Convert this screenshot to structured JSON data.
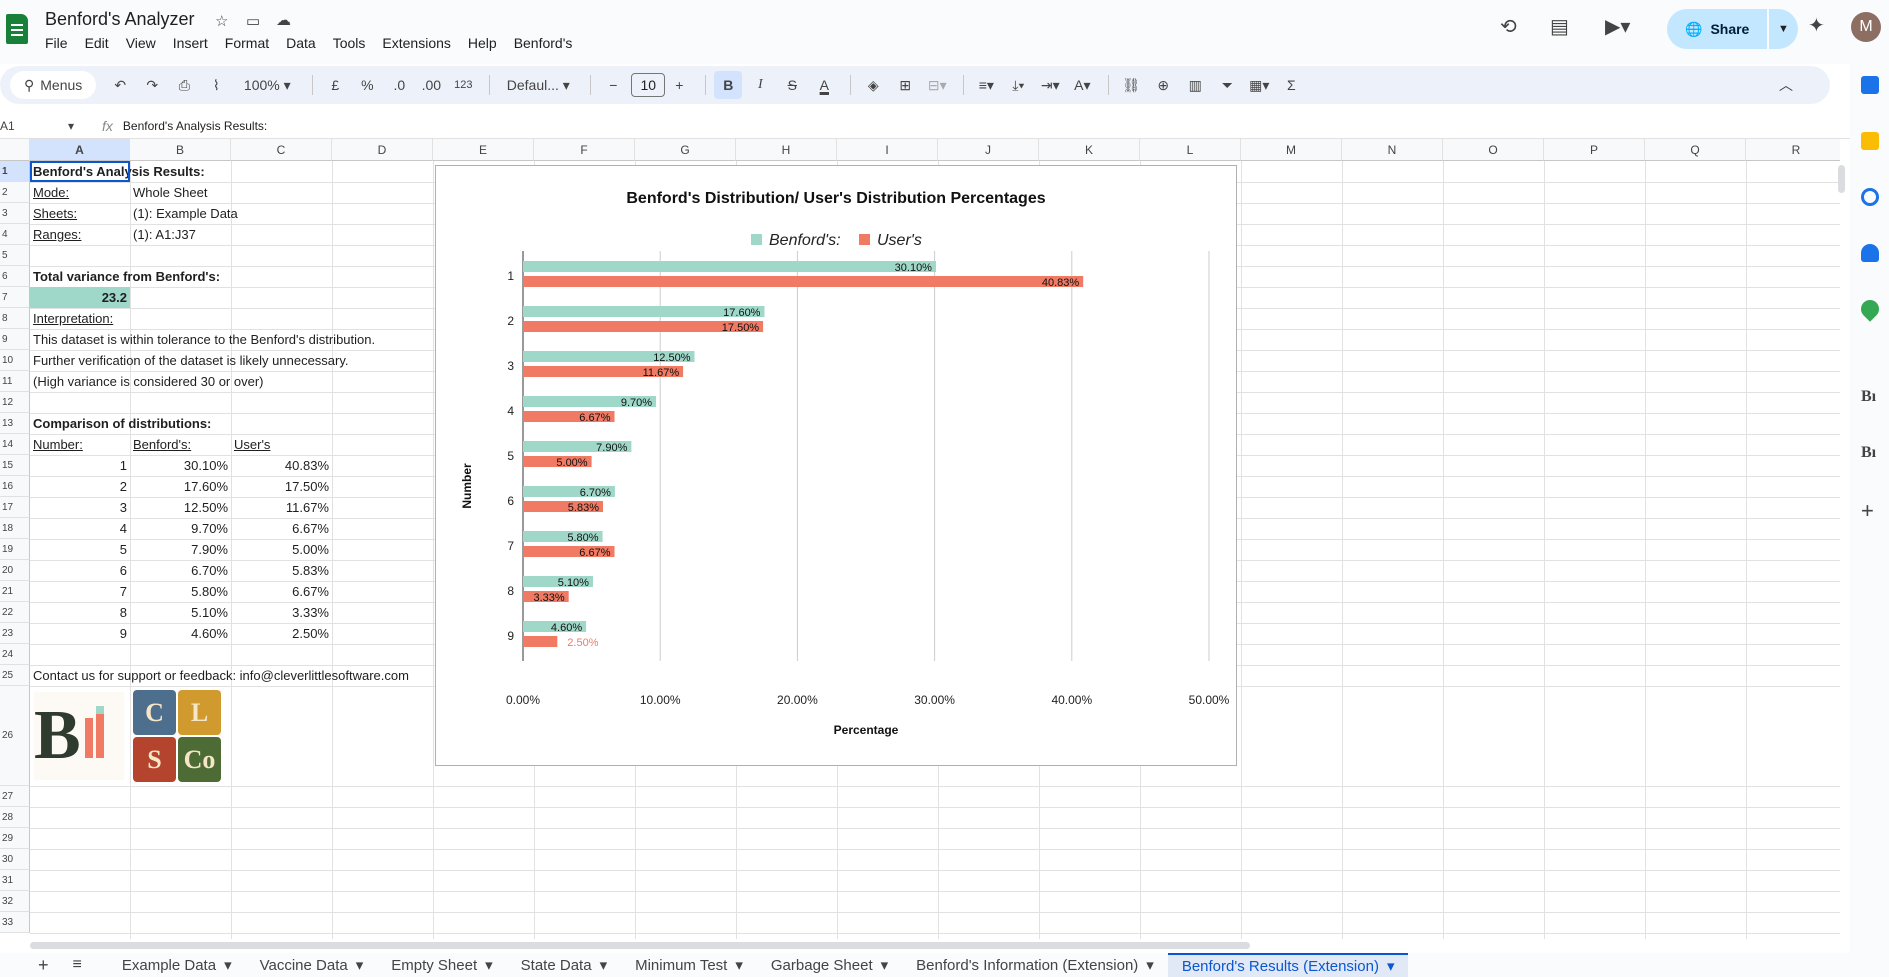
{
  "app": {
    "title": "Benford's Analyzer",
    "menus": [
      "File",
      "Edit",
      "View",
      "Insert",
      "Format",
      "Data",
      "Tools",
      "Extensions",
      "Help",
      "Benford's"
    ],
    "share_label": "Share",
    "avatar_initial": "M"
  },
  "toolbar": {
    "search_label": "Menus",
    "zoom": "100%",
    "currency": "£",
    "percent": "%",
    "dec_decrease": ".0",
    "dec_increase": ".00",
    "number_format": "123",
    "font": "Defaul...",
    "font_size": "10",
    "bold": "B",
    "italic": "I",
    "strike": "S",
    "text_color": "A"
  },
  "formula_bar": {
    "cell_ref": "A1",
    "content": "Benford's Analysis Results:"
  },
  "columns": [
    "A",
    "B",
    "C",
    "D",
    "E",
    "F",
    "G",
    "H",
    "I",
    "J",
    "K",
    "L",
    "M",
    "N",
    "O",
    "P",
    "Q",
    "R"
  ],
  "rows": [
    "1",
    "2",
    "3",
    "4",
    "5",
    "6",
    "7",
    "8",
    "9",
    "10",
    "11",
    "12",
    "13",
    "14",
    "15",
    "16",
    "17",
    "18",
    "19",
    "20",
    "21",
    "22",
    "23",
    "24",
    "25",
    "26",
    "27",
    "28",
    "29",
    "30",
    "31",
    "32",
    "33"
  ],
  "sheet": {
    "a1": "Benford's Analysis Results:",
    "mode_label": "Mode:",
    "mode_value": "Whole Sheet",
    "sheets_label": "Sheets:",
    "sheets_value": "(1): Example Data",
    "ranges_label": "Ranges:",
    "ranges_value": "(1): A1:J37",
    "variance_label": "Total variance from Benford's:",
    "variance_value": "23.2",
    "interp_label": "Interpretation:",
    "interp_1": "This dataset is within tolerance to the Benford's distribution.",
    "interp_2": "Further verification of the dataset is likely unnecessary.",
    "interp_3": "(High variance is considered 30 or over)",
    "comparison_title": "Comparison of distributions:",
    "col_number": "Number:",
    "col_benford": "Benford's:",
    "col_user": "User's",
    "table": [
      [
        "1",
        "30.10%",
        "40.83%"
      ],
      [
        "2",
        "17.60%",
        "17.50%"
      ],
      [
        "3",
        "12.50%",
        "11.67%"
      ],
      [
        "4",
        "9.70%",
        "6.67%"
      ],
      [
        "5",
        "7.90%",
        "5.00%"
      ],
      [
        "6",
        "6.70%",
        "5.83%"
      ],
      [
        "7",
        "5.80%",
        "6.67%"
      ],
      [
        "8",
        "5.10%",
        "3.33%"
      ],
      [
        "9",
        "4.60%",
        "2.50%"
      ]
    ],
    "contact": "Contact us for support or feedback: info@cleverlittlesoftware.com",
    "logo_blocks": [
      "C",
      "L",
      "S",
      "Co"
    ]
  },
  "chart_data": {
    "type": "bar",
    "orientation": "horizontal",
    "title": "Benford's Distribution/ User's Distribution Percentages",
    "xlabel": "Percentage",
    "ylabel": "Number",
    "categories": [
      "1",
      "2",
      "3",
      "4",
      "5",
      "6",
      "7",
      "8",
      "9"
    ],
    "series": [
      {
        "name": "Benford's:",
        "color": "#9fd8c8",
        "values": [
          30.1,
          17.6,
          12.5,
          9.7,
          7.9,
          6.7,
          5.8,
          5.1,
          4.6
        ],
        "labels": [
          "30.10%",
          "17.60%",
          "12.50%",
          "9.70%",
          "7.90%",
          "6.70%",
          "5.80%",
          "5.10%",
          "4.60%"
        ]
      },
      {
        "name": "User's",
        "color": "#f07a63",
        "values": [
          40.83,
          17.5,
          11.67,
          6.67,
          5.0,
          5.83,
          6.67,
          3.33,
          2.5
        ],
        "labels": [
          "40.83%",
          "17.50%",
          "11.67%",
          "6.67%",
          "5.00%",
          "5.83%",
          "6.67%",
          "3.33%",
          "2.50%"
        ]
      }
    ],
    "xlim": [
      0,
      50
    ],
    "xticks": [
      "0.00%",
      "10.00%",
      "20.00%",
      "30.00%",
      "40.00%",
      "50.00%"
    ],
    "legend_position": "top",
    "grid": true
  },
  "tabs": {
    "items": [
      "Example Data",
      "Vaccine Data",
      "Empty Sheet",
      "State Data",
      "Minimum Test",
      "Garbage Sheet",
      "Benford's Information (Extension)",
      "Benford's Results (Extension)"
    ],
    "active": 7
  },
  "colors": {
    "accent": "#0b57d0",
    "share_bg": "#c2e7ff",
    "sheets_green": "#188038",
    "variance_fill": "#9fd8c8"
  }
}
